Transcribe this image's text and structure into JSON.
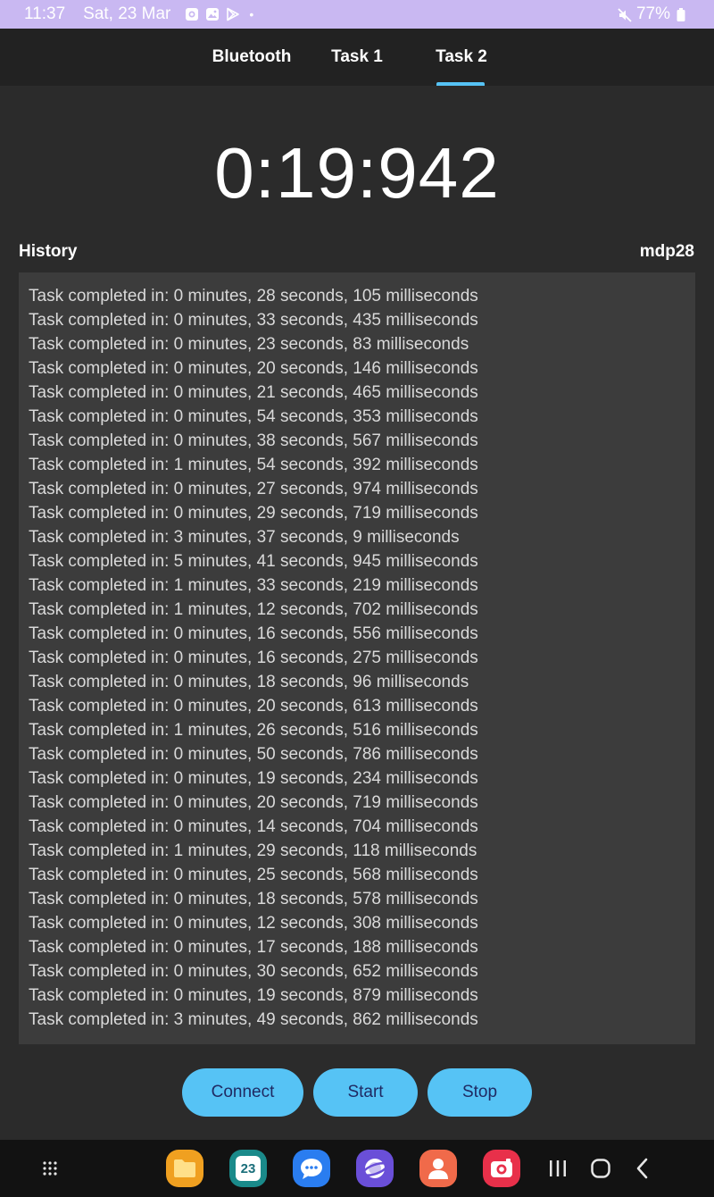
{
  "status_bar": {
    "time": "11:37",
    "date": "Sat, 23 Mar",
    "notification_icons": [
      "camera-icon",
      "gallery-icon",
      "play-store-icon"
    ],
    "dot": "•",
    "mute_icon": "mute-icon",
    "battery": "77%",
    "background": "#c9b8f2"
  },
  "tabs": [
    {
      "label": "Bluetooth",
      "active": false
    },
    {
      "label": "Task 1",
      "active": false
    },
    {
      "label": "Task 2",
      "active": true
    }
  ],
  "timer": "0:19:942",
  "history": {
    "title": "History",
    "device": "mdp28",
    "items": [
      "Task completed in: 0 minutes, 28 seconds, 105 milliseconds",
      "Task completed in: 0 minutes, 33 seconds, 435 milliseconds",
      "Task completed in: 0 minutes, 23 seconds, 83 milliseconds",
      "Task completed in: 0 minutes, 20 seconds, 146 milliseconds",
      "Task completed in: 0 minutes, 21 seconds, 465 milliseconds",
      "Task completed in: 0 minutes, 54 seconds, 353 milliseconds",
      "Task completed in: 0 minutes, 38 seconds, 567 milliseconds",
      "Task completed in: 1 minutes, 54 seconds, 392 milliseconds",
      "Task completed in: 0 minutes, 27 seconds, 974 milliseconds",
      "Task completed in: 0 minutes, 29 seconds, 719 milliseconds",
      "Task completed in: 3 minutes, 37 seconds, 9 milliseconds",
      "Task completed in: 5 minutes, 41 seconds, 945 milliseconds",
      "Task completed in: 1 minutes, 33 seconds, 219 milliseconds",
      "Task completed in: 1 minutes, 12 seconds, 702 milliseconds",
      "Task completed in: 0 minutes, 16 seconds, 556 milliseconds",
      "Task completed in: 0 minutes, 16 seconds, 275 milliseconds",
      "Task completed in: 0 minutes, 18 seconds, 96 milliseconds",
      "Task completed in: 0 minutes, 20 seconds, 613 milliseconds",
      "Task completed in: 1 minutes, 26 seconds, 516 milliseconds",
      "Task completed in: 0 minutes, 50 seconds, 786 milliseconds",
      "Task completed in: 0 minutes, 19 seconds, 234 milliseconds",
      "Task completed in: 0 minutes, 20 seconds, 719 milliseconds",
      "Task completed in: 0 minutes, 14 seconds, 704 milliseconds",
      "Task completed in: 1 minutes, 29 seconds, 118 milliseconds",
      "Task completed in: 0 minutes, 25 seconds, 568 milliseconds",
      "Task completed in: 0 minutes, 18 seconds, 578 milliseconds",
      "Task completed in: 0 minutes, 12 seconds, 308 milliseconds",
      "Task completed in: 0 minutes, 17 seconds, 188 milliseconds",
      "Task completed in: 0 minutes, 30 seconds, 652 milliseconds",
      "Task completed in: 0 minutes, 19 seconds, 879 milliseconds",
      "Task completed in: 3 minutes, 49 seconds, 862 milliseconds"
    ]
  },
  "buttons": {
    "connect": "Connect",
    "start": "Start",
    "stop": "Stop"
  },
  "navbar": {
    "calendar_day": "23",
    "apps": [
      "my-files-icon",
      "calendar-icon",
      "messages-icon",
      "internet-icon",
      "contacts-icon",
      "camera-app-icon"
    ],
    "keys": [
      "recents-icon",
      "home-icon",
      "back-icon"
    ]
  },
  "colors": {
    "accent": "#56c3f5",
    "button_text": "#1f2a63",
    "background": "#2b2b2b",
    "tab_bar": "#222222",
    "list_background": "#3c3c3c"
  }
}
